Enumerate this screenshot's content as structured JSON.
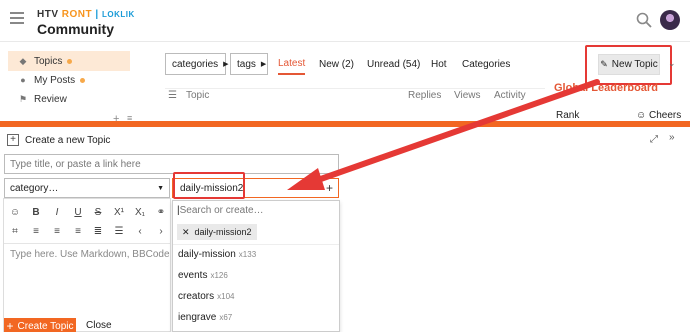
{
  "header": {
    "logo_top_a": "HTV",
    "logo_top_b": "RONT",
    "logo_top_sep": "|",
    "logo_top_c": "LOKLIK",
    "logo_bottom": "Community"
  },
  "sidebar": {
    "items": [
      {
        "label": "Topics",
        "icon": "layers-icon"
      },
      {
        "label": "My Posts",
        "icon": "user-icon"
      },
      {
        "label": "Review",
        "icon": "flag-icon"
      }
    ]
  },
  "nav": {
    "categories_label": "categories",
    "tags_label": "tags",
    "tabs": [
      "Latest",
      "New (2)",
      "Unread (54)",
      "Hot",
      "Categories"
    ],
    "active_tab": "Latest",
    "new_topic_label": "New Topic"
  },
  "topic_list": {
    "col_topic": "Topic",
    "col_replies": "Replies",
    "col_views": "Views",
    "col_activity": "Activity"
  },
  "leaderboard": {
    "title": "Global Leaderboard",
    "rank": "Rank",
    "cheers": "Cheers"
  },
  "composer": {
    "title": "Create a new Topic",
    "title_placeholder": "Type title, or paste a link here",
    "category_placeholder": "category…",
    "tag_value": "daily-mission2",
    "editor_placeholder": "Type here. Use Markdown, BBCode, or HT",
    "create_label": "Create Topic",
    "close_label": "Close"
  },
  "tag_dropdown": {
    "search_placeholder": "Search or create…",
    "selected_chip": "daily-mission2",
    "options": [
      {
        "name": "daily-mission",
        "count": "x133"
      },
      {
        "name": "events",
        "count": "x126"
      },
      {
        "name": "creators",
        "count": "x104"
      },
      {
        "name": "iengrave",
        "count": "x67"
      }
    ]
  },
  "colors": {
    "accent": "#f26722",
    "annotation": "#e53935",
    "active_tab": "#e45735"
  }
}
